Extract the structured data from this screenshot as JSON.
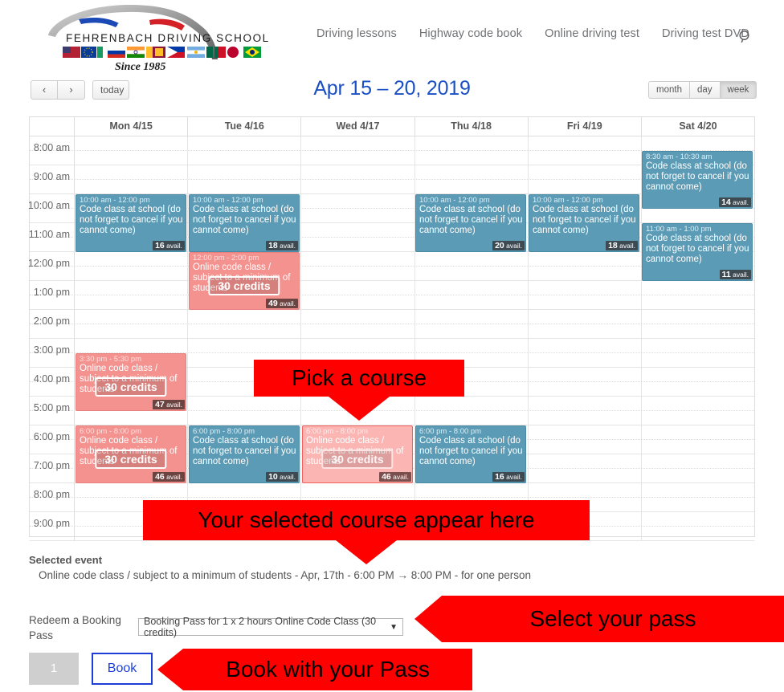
{
  "header": {
    "logo": {
      "name": "FEHRENBACH DRIVING SCHOOL",
      "tagline": "Since 1985"
    },
    "nav": [
      {
        "label": "Driving lessons"
      },
      {
        "label": "Highway code book"
      },
      {
        "label": "Online driving test"
      },
      {
        "label": "Driving test DVD"
      }
    ],
    "search_icon": "search-icon"
  },
  "toolbar": {
    "prev_label": "‹",
    "next_label": "›",
    "today_label": "today",
    "title": "Apr 15 – 20, 2019",
    "views": [
      {
        "label": "month",
        "active": false
      },
      {
        "label": "day",
        "active": false
      },
      {
        "label": "week",
        "active": true
      }
    ]
  },
  "calendar": {
    "days": [
      "Mon 4/15",
      "Tue 4/16",
      "Wed 4/17",
      "Thu 4/18",
      "Fri 4/19",
      "Sat 4/20"
    ],
    "times": [
      "8:00 am",
      "9:00 am",
      "10:00 am",
      "11:00 am",
      "12:00 pm",
      "1:00 pm",
      "2:00 pm",
      "3:00 pm",
      "4:00 pm",
      "5:00 pm",
      "6:00 pm",
      "7:00 pm",
      "8:00 pm",
      "9:00 pm"
    ],
    "slot_start": "8:00 am",
    "slot_end": "9:30 pm",
    "events": [
      {
        "day": 0,
        "start": "10:00 am",
        "end": "12:00 pm",
        "time_label": "10:00 am - 12:00 pm",
        "title": "Code class at school (do not forget to cancel if you cannot come)",
        "avail": "16",
        "avail_suffix": "avail.",
        "credits": null,
        "type": "blue",
        "selected": false
      },
      {
        "day": 1,
        "start": "10:00 am",
        "end": "12:00 pm",
        "time_label": "10:00 am - 12:00 pm",
        "title": "Code class at school (do not forget to cancel if you cannot come)",
        "avail": "18",
        "avail_suffix": "avail.",
        "credits": null,
        "type": "blue",
        "selected": false
      },
      {
        "day": 1,
        "start": "12:00 pm",
        "end": "2:00 pm",
        "time_label": "12:00 pm - 2:00 pm",
        "title": "Online code class / subject to a minimum of students",
        "avail": "49",
        "avail_suffix": "avail.",
        "credits": "30 credits",
        "type": "pink",
        "selected": false
      },
      {
        "day": 3,
        "start": "10:00 am",
        "end": "12:00 pm",
        "time_label": "10:00 am - 12:00 pm",
        "title": "Code class at school (do not forget to cancel if you cannot come)",
        "avail": "20",
        "avail_suffix": "avail.",
        "credits": null,
        "type": "blue",
        "selected": false
      },
      {
        "day": 4,
        "start": "10:00 am",
        "end": "12:00 pm",
        "time_label": "10:00 am - 12:00 pm",
        "title": "Code class at school (do not forget to cancel if you cannot come)",
        "avail": "18",
        "avail_suffix": "avail.",
        "credits": null,
        "type": "blue",
        "selected": false
      },
      {
        "day": 5,
        "start": "8:30 am",
        "end": "10:30 am",
        "time_label": "8:30 am - 10:30 am",
        "title": "Code class at school (do not forget to cancel if you cannot come)",
        "avail": "14",
        "avail_suffix": "avail.",
        "credits": null,
        "type": "blue",
        "selected": false
      },
      {
        "day": 5,
        "start": "11:00 am",
        "end": "1:00 pm",
        "time_label": "11:00 am - 1:00 pm",
        "title": "Code class at school (do not forget to cancel if you cannot come)",
        "avail": "11",
        "avail_suffix": "avail.",
        "credits": null,
        "type": "blue",
        "selected": false
      },
      {
        "day": 0,
        "start": "3:30 pm",
        "end": "5:30 pm",
        "time_label": "3:30 pm - 5:30 pm",
        "title": "Online code class / subject to a minimum of students",
        "avail": "47",
        "avail_suffix": "avail.",
        "credits": "30 credits",
        "type": "pink",
        "selected": false
      },
      {
        "day": 0,
        "start": "6:00 pm",
        "end": "8:00 pm",
        "time_label": "6:00 pm - 8:00 pm",
        "title": "Online code class / subject to a minimum of students",
        "avail": "46",
        "avail_suffix": "avail.",
        "credits": "30 credits",
        "type": "pink",
        "selected": false
      },
      {
        "day": 1,
        "start": "6:00 pm",
        "end": "8:00 pm",
        "time_label": "6:00 pm - 8:00 pm",
        "title": "Code class at school (do not forget to cancel if you cannot come)",
        "avail": "10",
        "avail_suffix": "avail.",
        "credits": null,
        "type": "blue",
        "selected": false
      },
      {
        "day": 2,
        "start": "6:00 pm",
        "end": "8:00 pm",
        "time_label": "6:00 pm - 8:00 pm",
        "title": "Online code class / subject to a minimum of students",
        "avail": "46",
        "avail_suffix": "avail.",
        "credits": "30 credits",
        "type": "pink",
        "selected": true
      },
      {
        "day": 3,
        "start": "6:00 pm",
        "end": "8:00 pm",
        "time_label": "6:00 pm - 8:00 pm",
        "title": "Code class at school (do not forget to cancel if you cannot come)",
        "avail": "16",
        "avail_suffix": "avail.",
        "credits": null,
        "type": "blue",
        "selected": false
      }
    ]
  },
  "annotations": [
    {
      "text": "Pick a course",
      "direction": "down"
    },
    {
      "text": "Your selected course appear here",
      "direction": "down"
    },
    {
      "text": "Select your pass",
      "direction": "left"
    },
    {
      "text": "Book with your Pass",
      "direction": "left"
    }
  ],
  "booking": {
    "selected_event_label": "Selected event",
    "selected_event_value": "Online code class / subject to a minimum of students - Apr, 17th - 6:00 PM → 8:00 PM - for one person",
    "redeem_label": "Redeem a Booking Pass",
    "pass_selected": "Booking Pass for 1 x 2 hours Online Code Class (30 credits)",
    "pass_caret": "▼",
    "quantity": "1",
    "book_label": "Book"
  },
  "colors": {
    "accent_blue": "#1a4fc4",
    "event_blue": "#5b9bb5",
    "event_pink": "#f3928f",
    "event_pink_selected": "#fbb6b4",
    "annotation_red": "#fe0000",
    "book_border": "#1d3fd8"
  }
}
